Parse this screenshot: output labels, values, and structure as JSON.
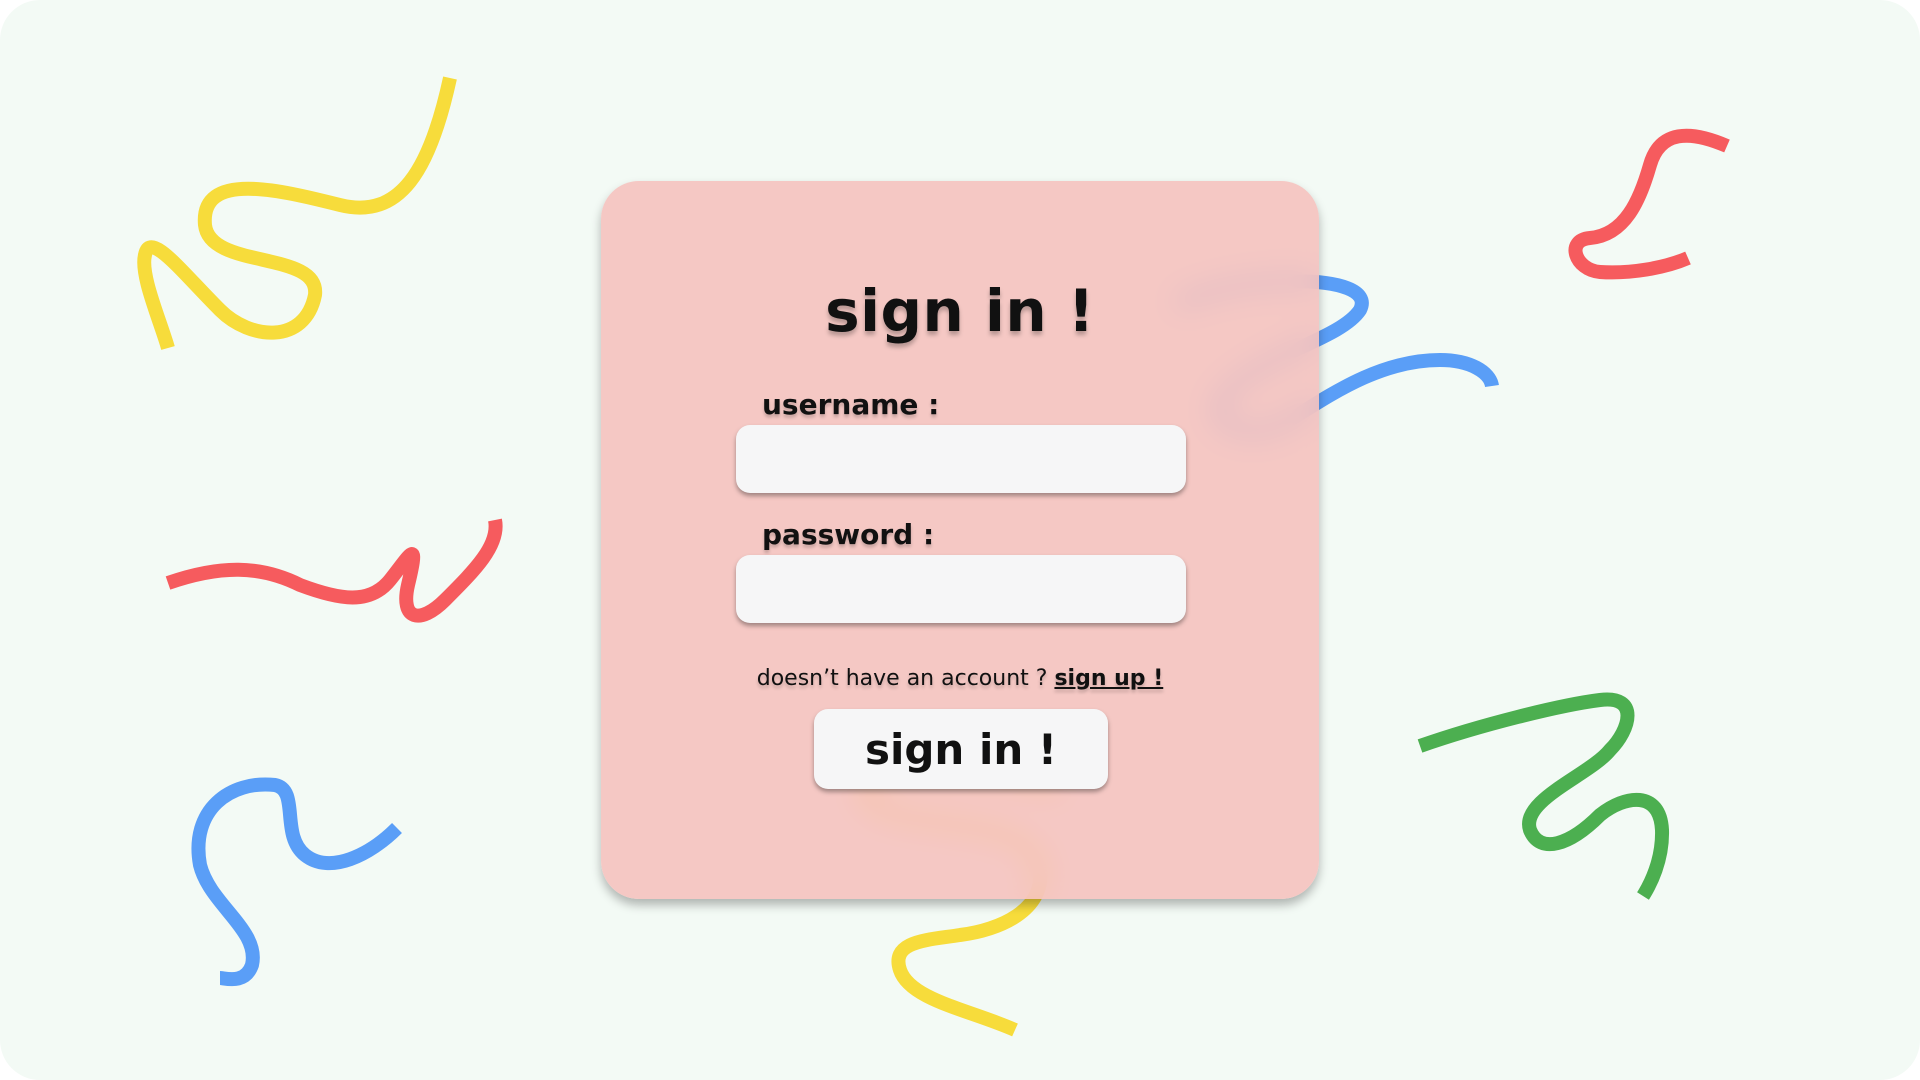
{
  "colors": {
    "background": "#f3faf5",
    "card": "#f5c3bf",
    "input": "#f6f6f7",
    "yellow": "#f7dc3b",
    "red": "#f65b5e",
    "blue": "#5a9ef7",
    "green": "#4caf50"
  },
  "form": {
    "title": "sign in !",
    "username_label": "username :",
    "username_value": "",
    "password_label": "password :",
    "password_value": "",
    "signup_prompt": "doesn’t have an account ? ",
    "signup_link": "sign up !",
    "submit_label": "sign in !"
  },
  "decorations": {
    "squiggle_count": 9
  }
}
